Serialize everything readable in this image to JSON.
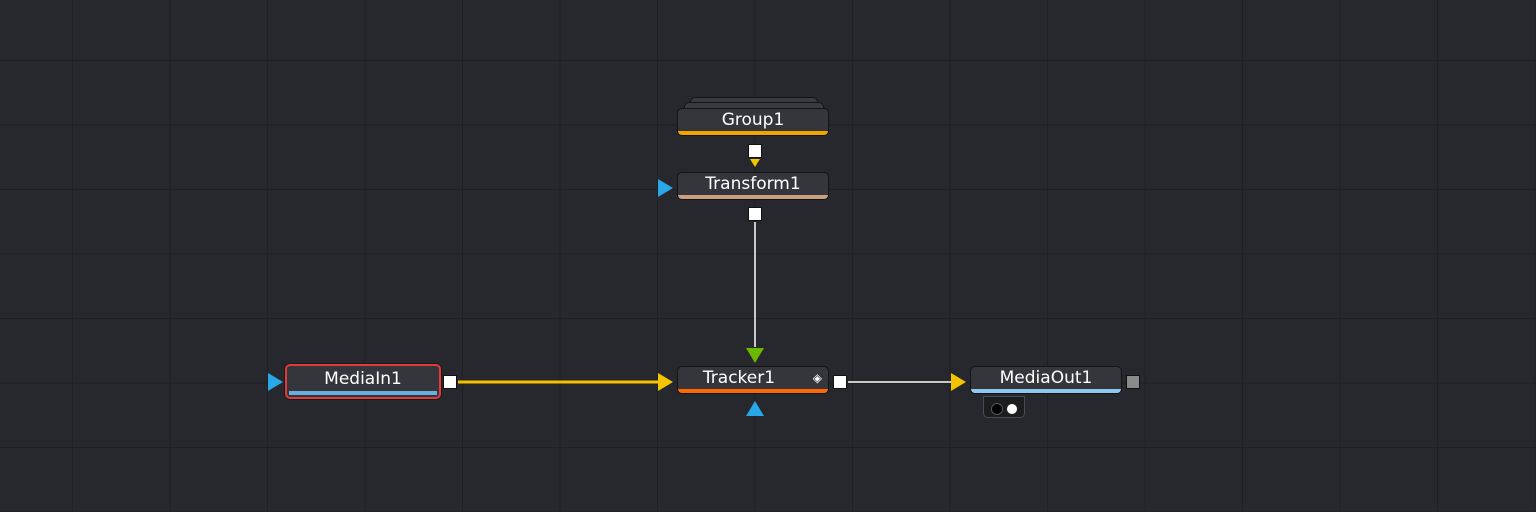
{
  "flow": {
    "nodes": {
      "group": {
        "label": "Group1",
        "color": "#f0a500"
      },
      "transform": {
        "label": "Transform1",
        "color": "#c8a080"
      },
      "mediain": {
        "label": "MediaIn1",
        "color": "#6aaee0",
        "selected": true
      },
      "tracker": {
        "label": "Tracker1",
        "color": "#ff6a00",
        "icon": "keyframe-diamond-icon",
        "icon_glyph": "◈"
      },
      "mediaout": {
        "label": "MediaOut1",
        "color": "#8ec8f0"
      }
    },
    "colors": {
      "background": "#27282d",
      "grid": "#1f2024",
      "wire_main": "#f5c400",
      "wire_secondary": "#ffffff",
      "input_background": "#f5c400",
      "input_effect_mask": "#2aa7e8",
      "input_foreground": "#6ab800",
      "output_port": "#ffffff",
      "output_port_disabled": "#8a8a8a"
    },
    "view_toggle": {
      "icon": "viewer-dots-icon"
    }
  }
}
